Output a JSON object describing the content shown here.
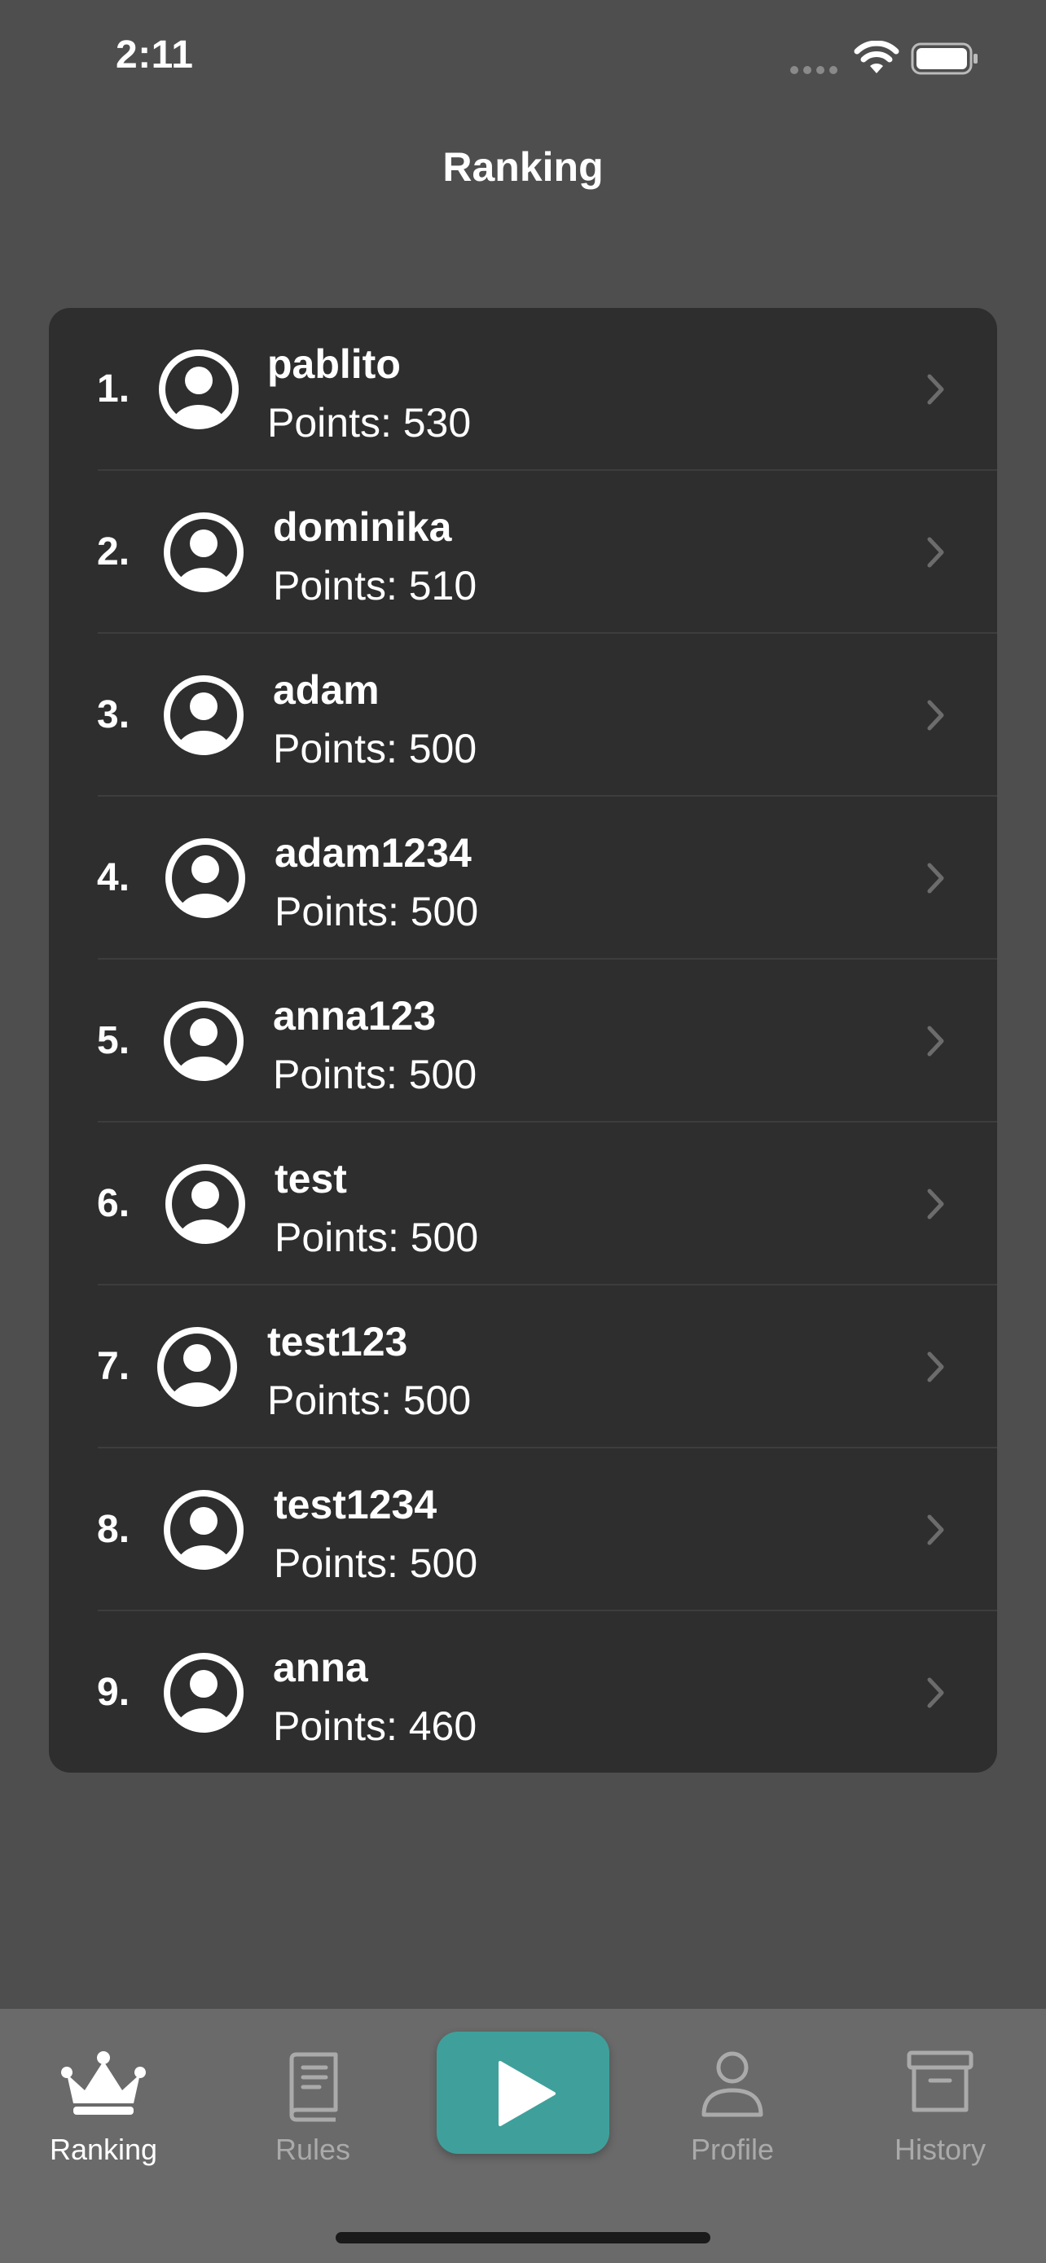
{
  "status_bar": {
    "time": "2:11"
  },
  "nav": {
    "title": "Ranking"
  },
  "ranking": [
    {
      "rank": "1.",
      "name": "pablito",
      "points": "Points: 530"
    },
    {
      "rank": "2.",
      "name": "dominika",
      "points": "Points: 510"
    },
    {
      "rank": "3.",
      "name": "adam",
      "points": "Points: 500"
    },
    {
      "rank": "4.",
      "name": "adam1234",
      "points": "Points: 500"
    },
    {
      "rank": "5.",
      "name": "anna123",
      "points": "Points: 500"
    },
    {
      "rank": "6.",
      "name": "test",
      "points": "Points: 500"
    },
    {
      "rank": "7.",
      "name": "test123",
      "points": "Points: 500"
    },
    {
      "rank": "8.",
      "name": "test1234",
      "points": "Points: 500"
    },
    {
      "rank": "9.",
      "name": "anna",
      "points": "Points: 460"
    }
  ],
  "tab_bar": {
    "ranking_label": "Ranking",
    "rules_label": "Rules",
    "profile_label": "Profile",
    "history_label": "History",
    "play_icon": "play-icon"
  },
  "colors": {
    "background": "#4e4e4e",
    "list_background": "#2e2e2e",
    "tab_bar_background": "#6a6a6a",
    "accent": "#3fa09b",
    "inactive_tab": "#aaaaaa"
  }
}
